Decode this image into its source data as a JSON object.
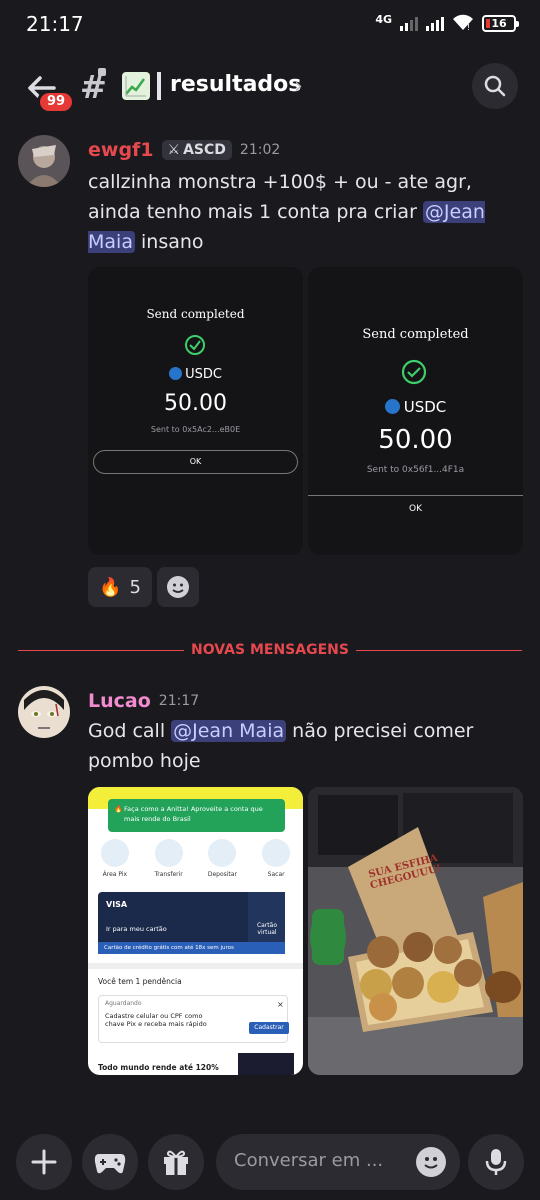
{
  "status": {
    "time": "21:17",
    "network": "4G",
    "battery": "16"
  },
  "header": {
    "unread_badge": "99",
    "channel_name": "resultados"
  },
  "messages": [
    {
      "username": "ewgf1",
      "role_tag": "ASCD",
      "time": "21:02",
      "text_parts": [
        "callzinha monstra +100$ + ou - ate agr, ainda tenho mais 1 conta pra criar ",
        "@Jean Maia",
        " insano"
      ],
      "attachments": [
        {
          "title": "Send completed",
          "token": "USDC",
          "amount": "50.00",
          "sent_to": "Sent to 0x5Ac2...eB0E",
          "button": "OK"
        },
        {
          "title": "Send completed",
          "token": "USDC",
          "amount": "50.00",
          "sent_to": "Sent to 0x56f1...4F1a",
          "button": "OK"
        }
      ],
      "reactions": [
        {
          "emoji": "🔥",
          "count": "5"
        }
      ]
    },
    {
      "username": "Lucao",
      "time": "21:17",
      "text_parts": [
        "God call ",
        "@Jean Maia",
        " não precisei comer pombo hoje"
      ],
      "bank_screenshot": {
        "banner": "Faça como a Anitta! Aproveite a conta que mais rende do Brasil",
        "actions": [
          "Área Pix",
          "Transferir",
          "Depositar",
          "Sacar"
        ],
        "card_brand": "VISA",
        "card_link": "Ir para meu cartão",
        "virtual_card": "Cartão virtual",
        "card_promo": "Cartão de crédito grátis com até 18x sem juros",
        "pending_title": "Você tem 1 pendência",
        "pending_status": "Aguardando",
        "pending_text": "Cadastre celular ou CPF como chave Pix e receba mais rápido",
        "pending_button": "Cadastrar",
        "promo": "Todo mundo rende até 120%"
      },
      "photo_box_text": [
        "SUA ESFIHA",
        "CHEGOUUU!"
      ]
    }
  ],
  "divider": "NOVAS MENSAGENS",
  "composer": {
    "placeholder": "Conversar em ..."
  },
  "colors": {
    "accent_red": "#e5484d",
    "mention_bg": "#3b3f7a",
    "username_pink": "#f28bd0"
  }
}
